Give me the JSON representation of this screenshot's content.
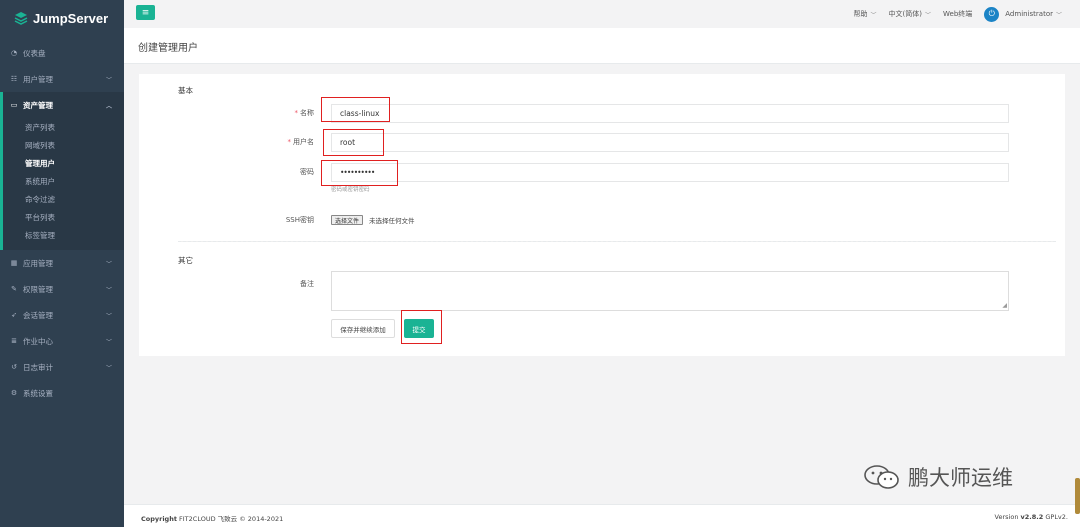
{
  "brand": {
    "name": "JumpServer"
  },
  "sidebar": {
    "items": [
      {
        "label": "仪表盘",
        "icon": "dashboard-icon"
      },
      {
        "label": "用户管理",
        "icon": "users-icon"
      }
    ],
    "active_group": {
      "label": "资产管理",
      "icon": "inbox-icon",
      "subitems": [
        {
          "label": "资产列表"
        },
        {
          "label": "网域列表"
        },
        {
          "label": "管理用户"
        },
        {
          "label": "系统用户"
        },
        {
          "label": "命令过滤"
        },
        {
          "label": "平台列表"
        },
        {
          "label": "标签管理"
        }
      ]
    },
    "items_after": [
      {
        "label": "应用管理",
        "icon": "grid-icon"
      },
      {
        "label": "权限管理",
        "icon": "edit-icon"
      },
      {
        "label": "会话管理",
        "icon": "rocket-icon"
      },
      {
        "label": "作业中心",
        "icon": "list-icon"
      },
      {
        "label": "日志审计",
        "icon": "history-icon"
      },
      {
        "label": "系统设置",
        "icon": "cogs-icon"
      }
    ]
  },
  "topbar": {
    "help": "帮助",
    "language": "中文(简体)",
    "web_terminal": "Web终端",
    "user": "Administrator"
  },
  "page": {
    "title": "创建管理用户"
  },
  "form": {
    "section_basic": "基本",
    "name_label": "名称",
    "name_value": "class-linux",
    "username_label": "用户名",
    "username_value": "root",
    "password_label": "密码",
    "password_value": "••••••••••",
    "password_help": "密码或密钥密码",
    "ssh_label": "SSH密钥",
    "file_button": "选择文件",
    "file_status": "未选择任何文件",
    "section_other": "其它",
    "comment_label": "备注",
    "save_continue": "保存并继续添加",
    "submit": "提交"
  },
  "footer": {
    "copyright_bold": "Copyright",
    "copyright_rest": "FIT2CLOUD 飞致云 © 2014-2021",
    "version_prefix": "Version",
    "version_number": "v2.8.2",
    "license": "GPLv2."
  },
  "watermark": {
    "text": "鹏大师运维"
  },
  "colors": {
    "sidebar": "#2f4050",
    "accent": "#1ab394",
    "highlight": "#e02020"
  }
}
